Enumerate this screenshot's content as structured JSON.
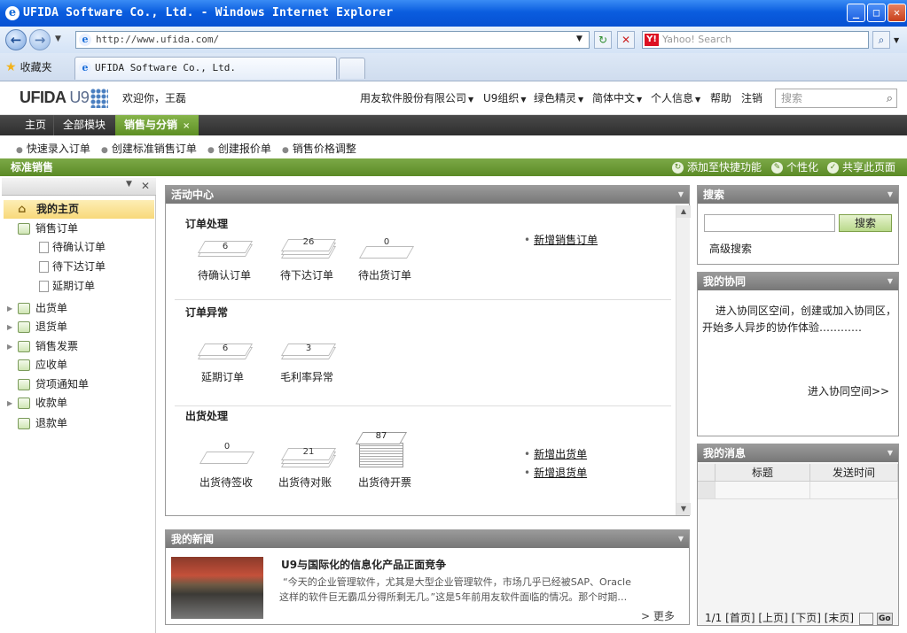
{
  "browser": {
    "title": "UFIDA Software Co., Ltd. - Windows Internet Explorer",
    "url": "http://www.ufida.com/",
    "search_placeholder": "Yahoo! Search",
    "favorites_label": "收藏夹",
    "tab_title": "UFIDA Software Co., Ltd.",
    "yahoo_badge": "Y!"
  },
  "app": {
    "logo": "UFIDA",
    "logo_u9": "U9",
    "welcome": "欢迎你，王磊",
    "header_nav": [
      "用友软件股份有限公司",
      "U9组织",
      "绿色精灵",
      "简体中文",
      "个人信息",
      "帮助",
      "注销"
    ],
    "search_placeholder": "搜索"
  },
  "main_nav": {
    "home": "主页",
    "all_modules": "全部模块",
    "active": "销售与分销",
    "close": "×"
  },
  "sub_nav": [
    "快速录入订单",
    "创建标准销售订单",
    "创建报价单",
    "销售价格调整"
  ],
  "band": {
    "title": "标准销售",
    "actions": [
      "添加至快捷功能",
      "个性化",
      "共享此页面"
    ]
  },
  "tree": {
    "home": "我的主页",
    "sales_order": "销售订单",
    "children": [
      "待确认订单",
      "待下达订单",
      "延期订单"
    ],
    "items": [
      "出货单",
      "退货单",
      "销售发票",
      "应收单",
      "贷项通知单",
      "收款单",
      "退款单"
    ],
    "expandable": [
      true,
      true,
      true,
      false,
      false,
      true,
      false
    ]
  },
  "activity": {
    "title": "活动中心",
    "order_processing": {
      "title": "订单处理",
      "items": [
        {
          "label": "待确认订单",
          "count": "6"
        },
        {
          "label": "待下达订单",
          "count": "26"
        },
        {
          "label": "待出货订单",
          "count": "0"
        }
      ],
      "links": [
        "新增销售订单"
      ]
    },
    "order_exception": {
      "title": "订单异常",
      "items": [
        {
          "label": "延期订单",
          "count": "6"
        },
        {
          "label": "毛利率异常",
          "count": "3"
        }
      ]
    },
    "shipping": {
      "title": "出货处理",
      "items": [
        {
          "label": "出货待签收",
          "count": "0"
        },
        {
          "label": "出货待对账",
          "count": "21"
        },
        {
          "label": "出货待开票",
          "count": "87"
        }
      ],
      "links": [
        "新增出货单",
        "新增退货单"
      ]
    }
  },
  "news": {
    "title": "我的新闻",
    "headline": "U9与国际化的信息化产品正面竞争",
    "body_line1": "“今天的企业管理软件，尤其是大型企业管理软件，市场几乎已经被SAP、Oracle",
    "body_line2": "这样的软件巨无霸瓜分得所剩无几。”这是5年前用友软件面临的情况。那个时期…",
    "more": "> 更多"
  },
  "search_panel": {
    "title": "搜索",
    "button": "搜索",
    "advanced": "高级搜索"
  },
  "collab": {
    "title": "我的协同",
    "text_line1": "进入协同区空间，创建或加入协同区，",
    "text_line2": "开始多人异步的协作体验…………",
    "link": "进入协同空间>>"
  },
  "messages": {
    "title": "我的消息",
    "columns": [
      "标题",
      "发送时间"
    ],
    "pager": [
      "1/1",
      "[首页]",
      "[上页]",
      "[下页]",
      "[末页]"
    ],
    "go": "Go"
  },
  "icons": [
    "ie-logo",
    "back-icon",
    "forward-icon",
    "refresh-icon",
    "stop-icon",
    "star-icon",
    "search-icon",
    "home-icon",
    "folder-icon",
    "page-icon",
    "paper-stack-icon",
    "check-circle-icon"
  ],
  "colors": {
    "accent_green": "#6d9a36",
    "nav_dark": "#333333",
    "title_blue": "#0a5ddf"
  }
}
